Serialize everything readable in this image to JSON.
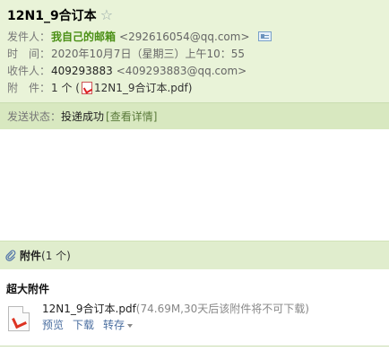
{
  "email": {
    "subject": "12N1_9合订本",
    "sender_label": "发件人：",
    "sender_name": "我自己的邮箱",
    "sender_addr": "<292616054@qq.com>",
    "time_label": "时　间：",
    "time_value": "2020年10月7日（星期三）上午10：55",
    "recipient_label": "收件人：",
    "recipient_name": "409293883",
    "recipient_addr": "<409293883@qq.com>",
    "attachment_label": "附　件：",
    "attachment_count": "1 个 (",
    "attachment_file": "12N1_9合订本.pdf",
    "attachment_close": ")"
  },
  "status": {
    "label": "发送状态：",
    "value": "投递成功",
    "detail_link": "[查看详情]"
  },
  "attachments": {
    "title": "附件",
    "count": "(1 个)",
    "section_head": "超大附件",
    "file_name": "12N1_9合订本.pdf",
    "file_note": "(74.69M,30天后该附件将不可下载)",
    "actions": {
      "preview": "预览",
      "download": "下载",
      "save": "转存"
    }
  },
  "colors": {
    "header_bg": "#e9f3d8",
    "status_bg": "#d8e8c0",
    "sender": "#4a8f15",
    "link": "#4a6ea0"
  },
  "icons": [
    "star-icon",
    "contact-card-icon",
    "pdf-icon",
    "paperclip-icon",
    "file-pdf-icon",
    "caret-down-icon"
  ]
}
